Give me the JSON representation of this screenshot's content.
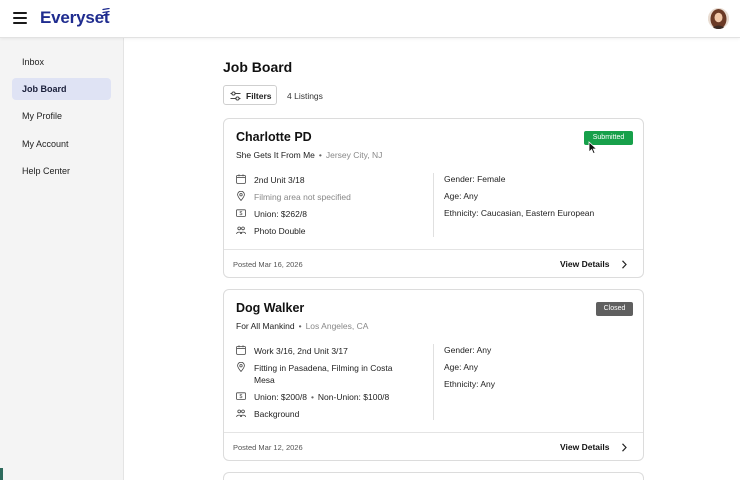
{
  "header": {
    "logo_text": "Everyset",
    "brand_color": "#1f2c8f"
  },
  "sidebar": {
    "items": [
      {
        "label": "Inbox",
        "active": false
      },
      {
        "label": "Job Board",
        "active": true
      },
      {
        "label": "My Profile",
        "active": false
      },
      {
        "label": "My Account",
        "active": false
      },
      {
        "label": "Help Center",
        "active": false
      }
    ]
  },
  "main": {
    "title": "Job Board",
    "filters_label": "Filters",
    "listing_count": "4 Listings",
    "cards": [
      {
        "title": "Charlotte PD",
        "production": "She Gets It From Me",
        "location": "Jersey City, NJ",
        "status": "Submitted",
        "status_color": "#17a04a",
        "schedule": "2nd Unit 3/18",
        "filming_location": "Filming area not specified",
        "pay": "Union: $262/8",
        "role_type": "Photo Double",
        "gender": "Gender: Female",
        "age": "Age: Any",
        "ethnicity": "Ethnicity: Caucasian, Eastern European",
        "posted": "Posted Mar 16, 2026",
        "view_details": "View Details"
      },
      {
        "title": "Dog Walker",
        "production": "For All Mankind",
        "location": "Los Angeles, CA",
        "status": "Closed",
        "status_color": "#5f5f5f",
        "schedule": "Work 3/16, 2nd Unit 3/17",
        "filming_location": "Fitting in Pasadena, Filming in Costa Mesa",
        "pay_union": "Union: $200/8",
        "pay_nonunion": "Non-Union: $100/8",
        "role_type": "Background",
        "gender": "Gender: Any",
        "age": "Age: Any",
        "ethnicity": "Ethnicity: Any",
        "posted": "Posted Mar 12, 2026",
        "view_details": "View Details"
      }
    ]
  },
  "icons": [
    "menu-icon",
    "logo-mark-icon",
    "filters-icon",
    "calendar-icon",
    "location-pin-icon",
    "dollar-icon",
    "people-icon",
    "chevron-right-icon",
    "mouse-cursor-icon"
  ]
}
